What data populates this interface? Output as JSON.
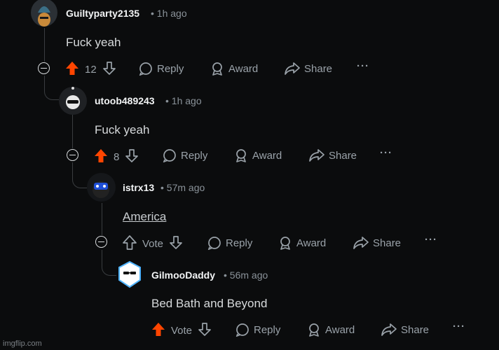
{
  "comments": [
    {
      "username": "Guiltyparty2135",
      "time": "1h ago",
      "body": "Fuck yeah",
      "score": "12",
      "vote_label": "",
      "upvoted": true
    },
    {
      "username": "utoob489243",
      "time": "1h ago",
      "body": "Fuck yeah",
      "score": "8",
      "vote_label": "",
      "upvoted": true
    },
    {
      "username": "istrx13",
      "time": "57m ago",
      "body": "America",
      "score": "",
      "vote_label": "Vote",
      "upvoted": false
    },
    {
      "username": "GilmooDaddy",
      "time": "56m ago",
      "body": "Bed Bath and Beyond",
      "score": "",
      "vote_label": "Vote",
      "upvoted": true
    }
  ],
  "actions": {
    "reply": "Reply",
    "award": "Award",
    "share": "Share",
    "more": "···"
  },
  "separator": "•",
  "watermark": "imgflip.com",
  "colors": {
    "upvote": "#ff4500",
    "background": "#0b0c0d",
    "text": "#d7dadc",
    "meta": "#8a9299"
  }
}
